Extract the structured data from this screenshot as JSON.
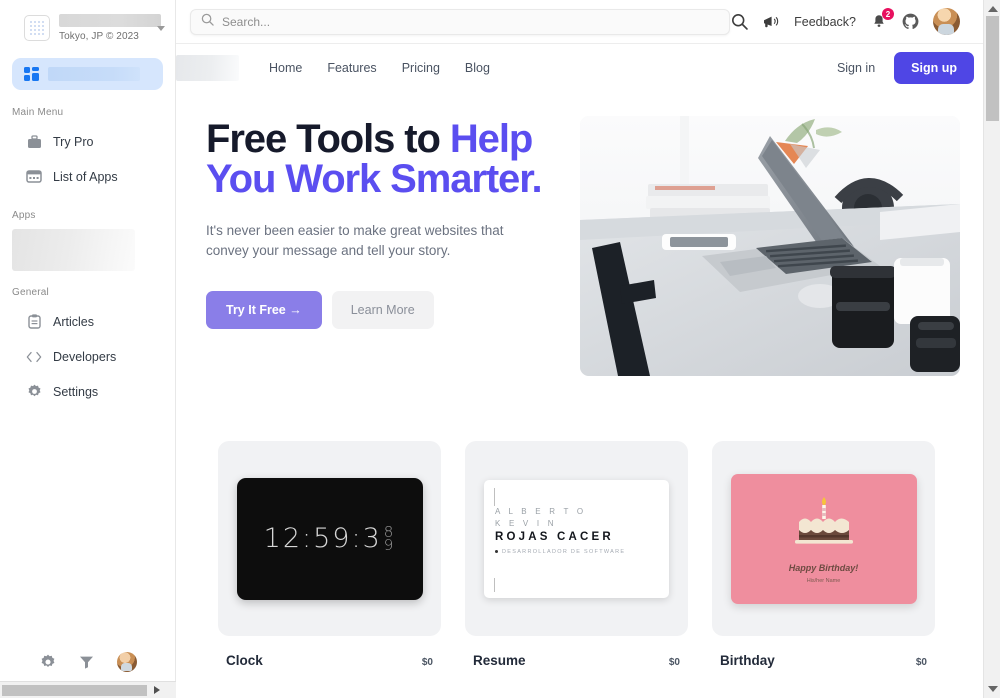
{
  "workspace": {
    "logo_icon": "dot-grid-icon",
    "name": "",
    "location": "Tokyo, JP © 2023",
    "caret_icon": "chevron-down-icon"
  },
  "sidebar": {
    "active_item": {
      "icon": "dashboard-grid-icon",
      "label": ""
    },
    "sections": [
      {
        "label": "Main Menu",
        "items": [
          {
            "icon": "briefcase-icon",
            "label": "Try Pro"
          },
          {
            "icon": "window-list-icon",
            "label": "List of Apps"
          }
        ]
      },
      {
        "label": "Apps",
        "items": []
      },
      {
        "label": "General",
        "items": [
          {
            "icon": "clipboard-icon",
            "label": "Articles"
          },
          {
            "icon": "code-brackets-icon",
            "label": "Developers"
          },
          {
            "icon": "gear-icon",
            "label": "Settings"
          }
        ]
      }
    ],
    "footer_icons": [
      "gear-icon",
      "filter-icon",
      "avatar"
    ]
  },
  "topbar": {
    "search": {
      "icon": "search-icon",
      "placeholder": "Search...",
      "value": ""
    },
    "search_icon": "search-icon",
    "feedback": {
      "icon": "megaphone-icon",
      "label": "Feedback?"
    },
    "notifications": {
      "icon": "bell-icon",
      "count": "2",
      "badge_color": "#e8105f"
    },
    "github_icon": "github-icon",
    "avatar": "user-avatar"
  },
  "site_header": {
    "logo": "",
    "nav": [
      "Home",
      "Features",
      "Pricing",
      "Blog"
    ],
    "sign_in": "Sign in",
    "sign_up": "Sign up",
    "sign_up_color": "#4f46e5"
  },
  "hero": {
    "headline_plain": "Free Tools to ",
    "headline_accent": "Help You Work Smarter.",
    "accent_color": "#5b4ef0",
    "paragraph": "It's never been easier to make great websites that convey your message and tell your story.",
    "primary_button": "Try It Free →",
    "primary_button_color": "#8a7ee8",
    "secondary_button": "Learn More",
    "image_alt": "desk-workspace-photo"
  },
  "cards": [
    {
      "title": "Clock",
      "price": "$0",
      "preview": {
        "kind": "clock",
        "time": "12:59:3",
        "roll_top": "8",
        "roll_bottom": "9",
        "bg": "#0d0d0d"
      }
    },
    {
      "title": "Resume",
      "price": "$0",
      "preview": {
        "kind": "resume",
        "line1": "A L B E R T O",
        "line2": "K E V I N",
        "line3": "ROJAS CACER",
        "line4": "DESARROLLADOR DE SOFTWARE",
        "bg": "#ffffff"
      }
    },
    {
      "title": "Birthday",
      "price": "$0",
      "preview": {
        "kind": "birthday",
        "title": "Happy Birthday!",
        "subtitle": "His/her Name",
        "bg": "#ef8e9e"
      }
    }
  ],
  "scrollbars": {
    "vertical": true,
    "horizontal": true
  }
}
